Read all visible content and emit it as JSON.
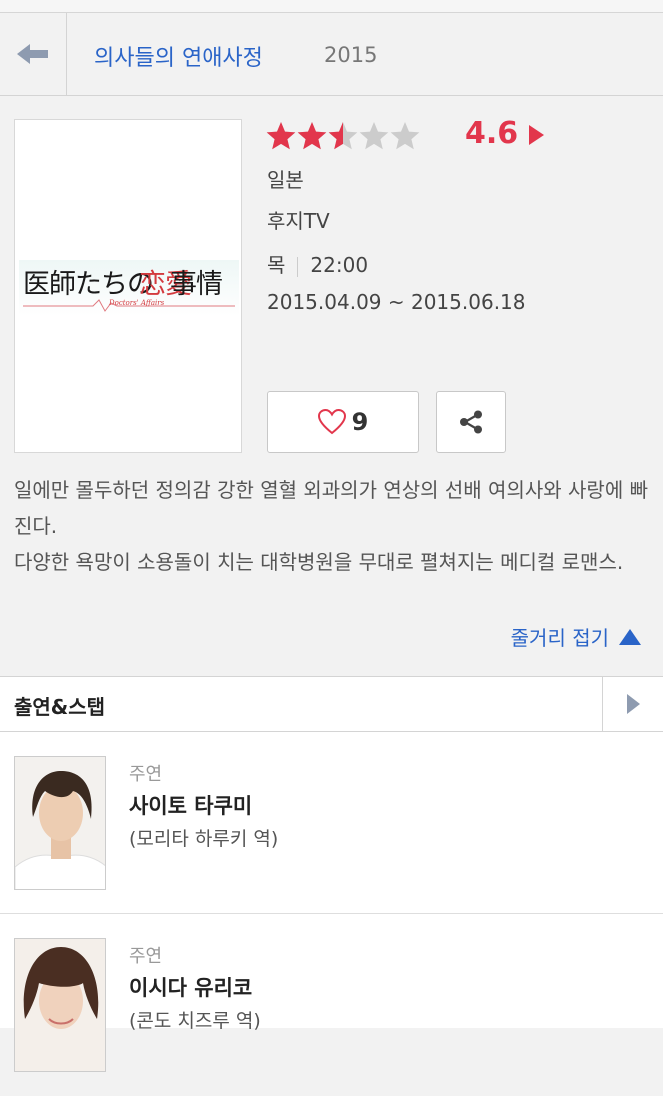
{
  "header": {
    "back_icon": "back-arrow-icon",
    "title": "의사들의 연애사정",
    "year": "2015"
  },
  "poster": {
    "logo_text_part1": "医師たちの",
    "logo_text_part2": "恋愛",
    "logo_text_part3": "事情",
    "logo_subtext": "Doctors' Affairs"
  },
  "rating": {
    "value": "4.6",
    "stars_filled": 2.5,
    "stars_total": 5,
    "star_color": "#e2364c",
    "star_empty_color": "#cccccc"
  },
  "info": {
    "country": "일본",
    "network": "후지TV",
    "day": "목",
    "time": "22:00",
    "period": "2015.04.09 ~ 2015.06.18"
  },
  "actions": {
    "like_count": "9",
    "like_icon": "heart-outline-icon",
    "share_icon": "share-icon"
  },
  "synopsis": {
    "line1": "일에만 몰두하던 정의감 강한 열혈 외과의가 연상의 선배 여의사와 사랑에 빠진다.",
    "line2": "다양한 욕망이 소용돌이 치는 대학병원을 무대로 펼쳐지는 메디컬 로맨스.",
    "fold_label": "줄거리 접기"
  },
  "cast_section": {
    "title": "출연&스탭",
    "items": [
      {
        "role": "주연",
        "name": "사이토 타쿠미",
        "character": "(모리타 하루키 역)"
      },
      {
        "role": "주연",
        "name": "이시다 유리코",
        "character": "(콘도 치즈루 역)"
      }
    ]
  },
  "colors": {
    "accent_link": "#2a64c8",
    "rating_red": "#e2364c",
    "background": "#f2f2f2"
  }
}
